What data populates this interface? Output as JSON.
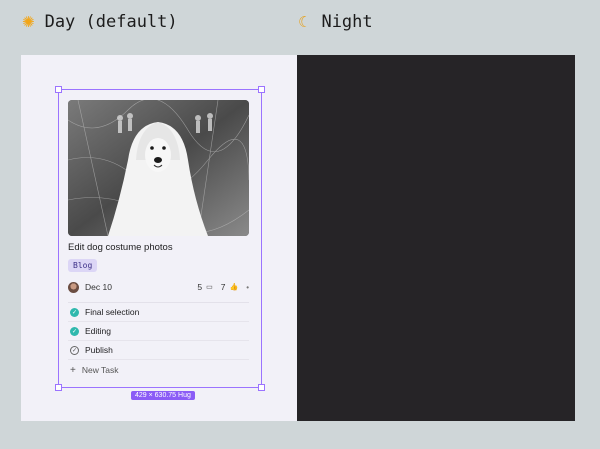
{
  "modes": {
    "day": {
      "icon": "sun-icon",
      "label": "Day (default)"
    },
    "night": {
      "icon": "moon-icon",
      "label": "Night"
    }
  },
  "card": {
    "image_alt": "dog in ghost costume",
    "title": "Edit dog costume photos",
    "tag": "Blog",
    "date": "Dec 10",
    "comments": "5",
    "likes": "7",
    "subtasks": [
      {
        "label": "Final selection",
        "status": "done"
      },
      {
        "label": "Editing",
        "status": "done"
      },
      {
        "label": "Publish",
        "status": "open"
      }
    ],
    "new_task_label": "New Task"
  },
  "selection": {
    "size_label": "429 × 630.75 Hug"
  },
  "colors": {
    "accent": "#9b73ff",
    "check_done": "#2fb8ad",
    "night_bg": "#262427",
    "day_bg": "#f2f1f8"
  }
}
